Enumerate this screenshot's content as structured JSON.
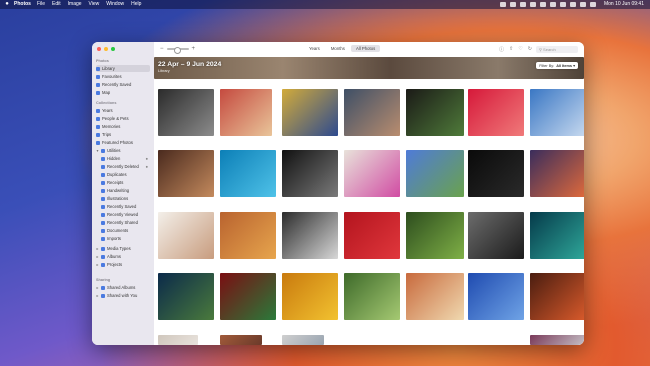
{
  "menubar": {
    "app": "Photos",
    "items": [
      "File",
      "Edit",
      "Image",
      "View",
      "Window",
      "Help"
    ],
    "clock": "Mon 10 Jun 09:41"
  },
  "sidebar": {
    "sections": [
      {
        "label": "Photos",
        "items": [
          {
            "label": "Library",
            "selected": true
          },
          {
            "label": "Favourites"
          },
          {
            "label": "Recently Saved"
          },
          {
            "label": "Map"
          }
        ]
      },
      {
        "label": "Collections",
        "items": [
          {
            "label": "Years"
          },
          {
            "label": "People & Pets"
          },
          {
            "label": "Memories"
          },
          {
            "label": "Trips"
          },
          {
            "label": "Featured Photos"
          },
          {
            "label": "Utilities",
            "expanded": true,
            "children": [
              {
                "label": "Hidden"
              },
              {
                "label": "Recently Deleted"
              },
              {
                "label": "Duplicates"
              },
              {
                "label": "Receipts"
              },
              {
                "label": "Handwriting"
              },
              {
                "label": "Illustrations"
              },
              {
                "label": "Recently Saved"
              },
              {
                "label": "Recently Viewed"
              },
              {
                "label": "Recently Shared"
              },
              {
                "label": "Documents"
              },
              {
                "label": "Imports"
              }
            ]
          },
          {
            "label": "Media Types"
          },
          {
            "label": "Albums"
          },
          {
            "label": "Projects"
          }
        ]
      },
      {
        "label": "Sharing",
        "items": [
          {
            "label": "Shared Albums"
          },
          {
            "label": "Shared with You"
          }
        ]
      }
    ]
  },
  "toolbar": {
    "segments": [
      "Years",
      "Months",
      "All Photos"
    ],
    "active_segment": "All Photos",
    "search_placeholder": "Search"
  },
  "header": {
    "date_range": "22 Apr – 9 Jun 2024",
    "subtitle": "Library",
    "filter_label": "Filter By:",
    "filter_value": "All Items"
  },
  "colors": {
    "accent": "#4a7ae0",
    "sidebar_bg": "#e9e7ef"
  }
}
